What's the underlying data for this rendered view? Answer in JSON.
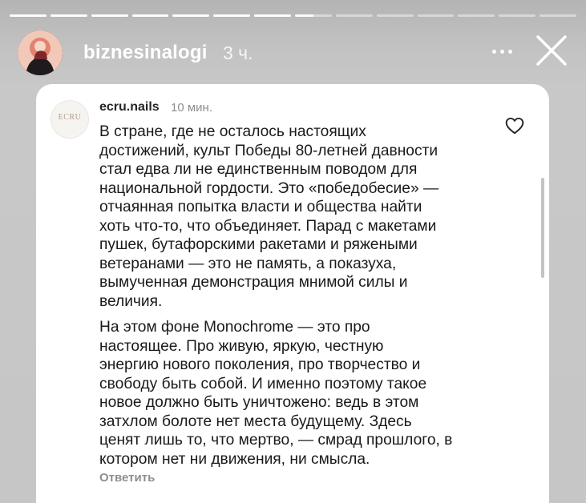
{
  "story": {
    "progress": {
      "total": 14,
      "completed": 7,
      "current_fraction": 0.5
    },
    "header": {
      "username": "biznesinalogi",
      "time": "3 ч.",
      "more_icon": "more-horizontal-icon",
      "close_icon": "close-icon"
    }
  },
  "comment": {
    "username": "ecru.nails",
    "time": "10 мин.",
    "avatar_logo": "ECRU",
    "paragraphs": [
      "В стране, где не осталось настоящих\nдостижений, культ Победы 80-летней давности\nстал едва ли не единственным поводом для\nнациональной гордости. Это «победобесие» —\nотчаянная попытка власти и общества найти\nхоть что-то, что объединяет. Парад с макетами\nпушек, бутафорскими ракетами и ряжеными\nветеранами — это не память, а показуха,\nвымученная демонстрация мнимой силы и\nвеличия.",
      "На этом фоне Monochrome — это про\nнастоящее. Про живую, яркую, честную\nэнергию нового поколения, про творчество и\nсвободу быть собой. И именно поэтому такое\nновое должно быть уничтожено: ведь в этом\nзатхлом болоте нет места будущему. Здесь\nценят лишь то, что мертво, — смрад прошлого, в\nкотором нет ни движения, ни смысла."
    ],
    "reply_label": "Ответить",
    "like_icon": "heart-icon"
  }
}
